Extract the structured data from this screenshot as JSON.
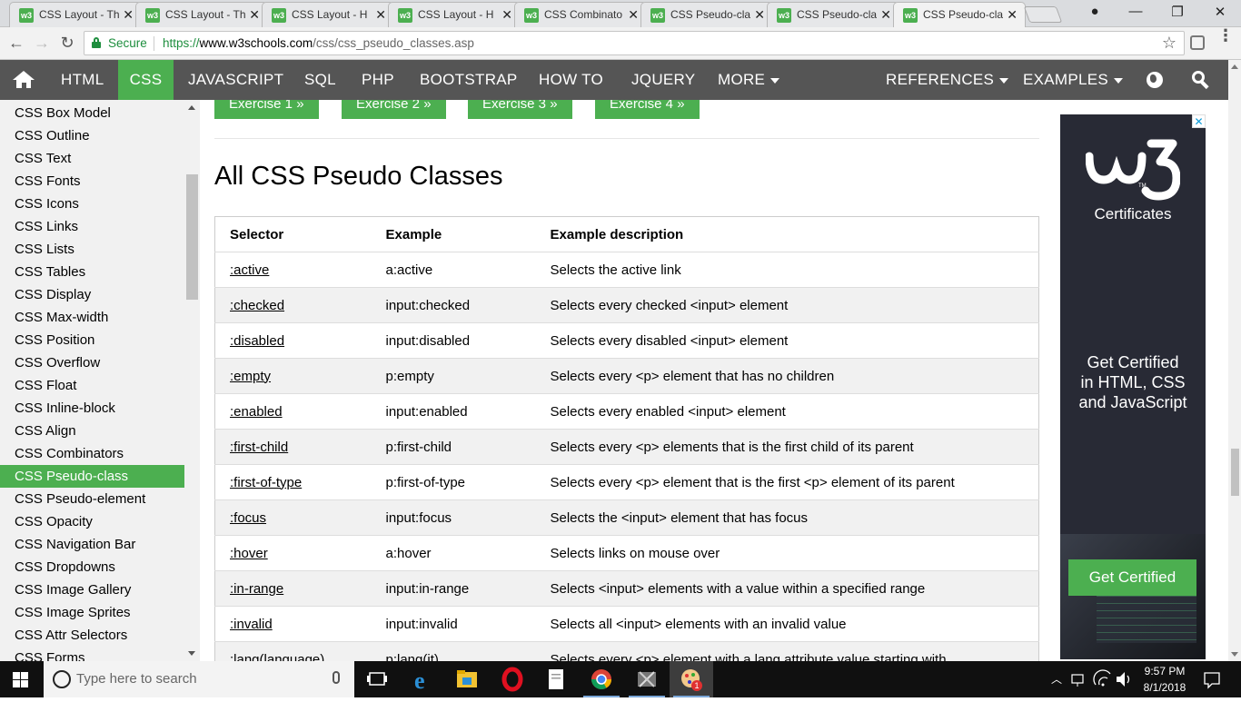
{
  "browser": {
    "tabs": [
      {
        "title": "CSS Layout - Th"
      },
      {
        "title": "CSS Layout - Th"
      },
      {
        "title": "CSS Layout - H"
      },
      {
        "title": "CSS Layout - H"
      },
      {
        "title": "CSS Combinato"
      },
      {
        "title": "CSS Pseudo-cla"
      },
      {
        "title": "CSS Pseudo-cla"
      },
      {
        "title": "CSS Pseudo-cla"
      }
    ],
    "active_tab_index": 7,
    "favicon_text": "w3",
    "tab_close_glyph": "✕",
    "secure_label": "Secure",
    "url": {
      "scheme": "https://",
      "host": "www.w3schools.com",
      "path": "/css/css_pseudo_classes.asp"
    },
    "nav_icons": {
      "back": "←",
      "forward": "→",
      "reload": "↻",
      "star": "☆",
      "menu": "⋮"
    },
    "window_controls": {
      "minimize": "—",
      "maximize": "❐",
      "close": "✕"
    },
    "profile_icon": "●"
  },
  "topnav": {
    "items": [
      "HTML",
      "CSS",
      "JAVASCRIPT",
      "SQL",
      "PHP",
      "BOOTSTRAP",
      "HOW TO",
      "JQUERY",
      "MORE"
    ],
    "active": "CSS",
    "right_items": [
      "REFERENCES",
      "EXAMPLES"
    ]
  },
  "sidebar": {
    "items": [
      "CSS Box Model",
      "CSS Outline",
      "CSS Text",
      "CSS Fonts",
      "CSS Icons",
      "CSS Links",
      "CSS Lists",
      "CSS Tables",
      "CSS Display",
      "CSS Max-width",
      "CSS Position",
      "CSS Overflow",
      "CSS Float",
      "CSS Inline-block",
      "CSS Align",
      "CSS Combinators",
      "CSS Pseudo-class",
      "CSS Pseudo-element",
      "CSS Opacity",
      "CSS Navigation Bar",
      "CSS Dropdowns",
      "CSS Image Gallery",
      "CSS Image Sprites",
      "CSS Attr Selectors",
      "CSS Forms"
    ],
    "active_index": 16
  },
  "main": {
    "exercise_buttons": [
      "Exercise 1 »",
      "Exercise 2 »",
      "Exercise 3 »",
      "Exercise 4 »"
    ],
    "title": "All CSS Pseudo Classes",
    "table": {
      "headers": [
        "Selector",
        "Example",
        "Example description"
      ],
      "rows": [
        [
          ":active",
          "a:active",
          "Selects the active link"
        ],
        [
          ":checked",
          "input:checked",
          "Selects every checked <input> element"
        ],
        [
          ":disabled",
          "input:disabled",
          "Selects every disabled <input> element"
        ],
        [
          ":empty",
          "p:empty",
          "Selects every <p> element that has no children"
        ],
        [
          ":enabled",
          "input:enabled",
          "Selects every enabled <input> element"
        ],
        [
          ":first-child",
          "p:first-child",
          "Selects every <p> elements that is the first child of its parent"
        ],
        [
          ":first-of-type",
          "p:first-of-type",
          "Selects every <p> element that is the first <p> element of its parent"
        ],
        [
          ":focus",
          "input:focus",
          "Selects the <input> element that has focus"
        ],
        [
          ":hover",
          "a:hover",
          "Selects links on mouse over"
        ],
        [
          ":in-range",
          "input:in-range",
          "Selects <input> elements with a value within a specified range"
        ],
        [
          ":invalid",
          "input:invalid",
          "Selects all <input> elements with an invalid value"
        ],
        [
          ":lang(language)",
          "p:lang(it)",
          "Selects every <p> element with a lang attribute value starting with"
        ]
      ]
    }
  },
  "ad": {
    "close_glyph": "✕",
    "cert_label": "Certificates",
    "headline_lines": [
      "Get Certified",
      "in HTML, CSS",
      "and JavaScript"
    ],
    "button": "Get Certified"
  },
  "taskbar": {
    "search_placeholder": "Type here to search",
    "time": "9:57 PM",
    "date": "8/1/2018",
    "notification_badge": "1"
  },
  "colors": {
    "accent_green": "#4caf50",
    "nav_dark": "#555555",
    "ad_bg": "#282a35"
  }
}
